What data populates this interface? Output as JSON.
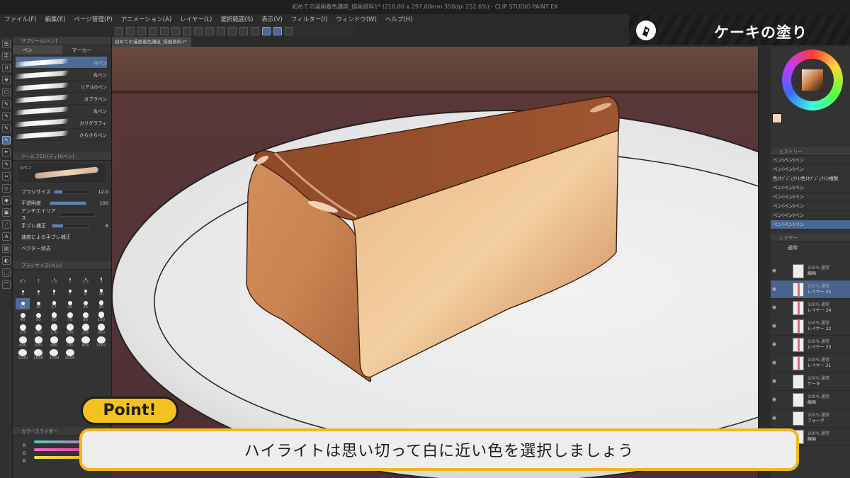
{
  "window": {
    "title": "初めての漫画着色講座_描画資料1* (210.00 x 297.00mm 350dpi 252.6%) - CLIP STUDIO PAINT EX"
  },
  "menu": [
    "ファイル(F)",
    "編集(E)",
    "ページ管理(P)",
    "アニメーション(A)",
    "レイヤー(L)",
    "選択範囲(S)",
    "表示(V)",
    "フィルター(I)",
    "ウィンドウ(W)",
    "ヘルプ(H)"
  ],
  "document_tab": "初めての漫画着色講座_描画資料1*",
  "tools": [
    "虫",
    "手",
    "↺",
    "✥",
    "□",
    "✎",
    "✎",
    "✎",
    "✎",
    "✒",
    "✎",
    "≈",
    "◇",
    "◉",
    "▣",
    "⟋",
    "A",
    "▤",
    "◐",
    "⬚",
    "⌒"
  ],
  "sub_tool": {
    "header": "サブツール[ペン]",
    "tabs": [
      "ペン",
      "マーカー"
    ],
    "brushes": [
      "Gペン",
      "丸ペン",
      "リアルGペン",
      "カブラペン",
      "丸ペン",
      "カリグラフィ",
      "さらさらペン"
    ],
    "selected_brush_index": 0
  },
  "tool_property": {
    "header": "ツールプロパティ[Gペン]",
    "preview_name": "Gペン",
    "rows": [
      {
        "label": "ブラシサイズ",
        "value": "12.0",
        "fill": 0.22
      },
      {
        "label": "不透明度",
        "value": "100",
        "fill": 1.0
      },
      {
        "label": "アンチエイリアス",
        "value": "",
        "fill": 0
      },
      {
        "label": "手ブレ補正",
        "value": "6",
        "fill": 0.3
      },
      {
        "label": "速度による手ブレ補正",
        "value": "",
        "fill": 0
      }
    ],
    "vector_label": "ベクター消去"
  },
  "brush_size": {
    "header": "ブラシサイズ[ペン]",
    "sizes": [
      "0.7",
      "1",
      "1.5",
      "2",
      "2.5",
      "3",
      "4",
      "5",
      "6",
      "7",
      "8",
      "10",
      "12",
      "15",
      "17",
      "20",
      "25",
      "30",
      "40",
      "50",
      "60",
      "70",
      "80",
      "100",
      "120",
      "150",
      "170",
      "200",
      "250",
      "300",
      "400",
      "500",
      "600",
      "700",
      "800",
      "1000",
      "1200",
      "1500",
      "1700",
      "2000"
    ],
    "selected_index": 12
  },
  "color_panel": {
    "header": "カラースライダー",
    "channels": [
      "R",
      "G",
      "B"
    ]
  },
  "history": {
    "header": "ヒストリー",
    "items": [
      "ペン(ペン)ペン",
      "ペン(ペン)ペン",
      "色(ｵﾌﾞｼﾞｪｸﾄ)/色(ｵﾌﾞｼﾞｪｸﾄ)/複製",
      "ペン(ペン)ペン",
      "ペン(ペン)ペン",
      "ペン(ペン)ペン",
      "ペン(ペン)ペン",
      "ペン(ペン)ペン"
    ],
    "selected_index": 7
  },
  "layers": {
    "header": "レイヤー",
    "blend": "通常",
    "items": [
      {
        "mode": "100% 通常",
        "name": "線画"
      },
      {
        "mode": "100% 通常",
        "name": "レイヤー 25"
      },
      {
        "mode": "100% 通常",
        "name": "レイヤー 24"
      },
      {
        "mode": "100% 通常",
        "name": "レイヤー 22"
      },
      {
        "mode": "100% 通常",
        "name": "レイヤー 23"
      },
      {
        "mode": "100% 通常",
        "name": "レイヤー 21"
      },
      {
        "mode": "100% 通常",
        "name": "ケーキ"
      },
      {
        "mode": "100% 通常",
        "name": "線画"
      },
      {
        "mode": "100% 通常",
        "name": "フォーク"
      },
      {
        "mode": "100% 通常",
        "name": "線画"
      }
    ],
    "selected_index": 1
  },
  "overlay": {
    "brand_title": "ケーキの塗り",
    "point_label": "Point!",
    "caption": "ハイライトは思い切って白に近い色を選択しましょう"
  },
  "colors": {
    "accent": "#f3b81c",
    "selection": "#4c6b97",
    "main_color": "#f3d6b8"
  }
}
